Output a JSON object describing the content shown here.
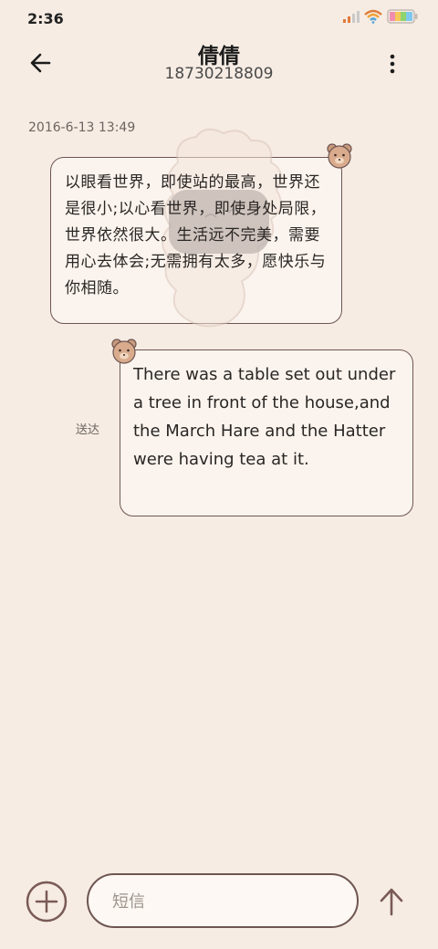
{
  "status_bar": {
    "time": "2:36",
    "icons": [
      "signal-icon",
      "wifi-icon",
      "battery-icon"
    ]
  },
  "header": {
    "contact_name": "倩倩",
    "contact_number": "18730218809",
    "back_icon": "arrow-left-icon",
    "more_icon": "more-vertical-icon"
  },
  "conversation": {
    "timestamp": "2016-6-13 13:49",
    "incoming_message": "以眼看世界，即使站的最高，世界还是很小;以心看世界，即使身处局限，世界依然很大。生活远不完美，需要用心去体会;无需拥有太多，愿快乐与你相随。",
    "outgoing_message": "There was a table set out under a tree in front of the house,and the March Hare and the Hatter were having tea at it.",
    "outgoing_status": "送达"
  },
  "composer": {
    "placeholder": "短信",
    "add_icon": "plus-circle-icon",
    "send_icon": "arrow-up-icon"
  },
  "theme": {
    "background": "#f6ece3",
    "bubble_border": "#6e5552",
    "bubble_fill": "#fbf4ee"
  }
}
